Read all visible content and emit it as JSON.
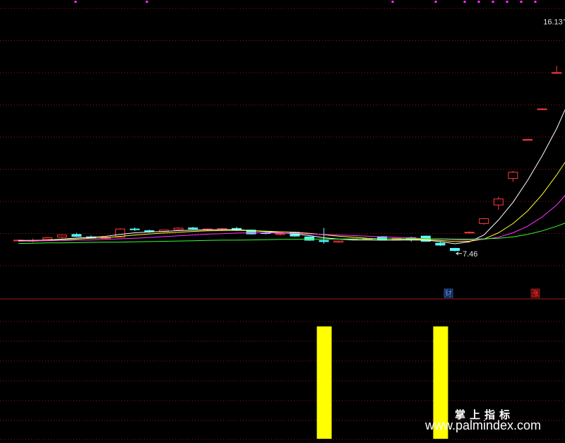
{
  "colors": {
    "background": "#000000",
    "grid": "#8b1a1a",
    "candle_up": "#ff3b3b",
    "candle_down": "#54ffff",
    "ma1": "#ffffff",
    "ma2": "#ffff33",
    "ma3": "#ff33ff",
    "ma4": "#33ff33",
    "volume_bar": "#ffff00",
    "marker_dot": "#ff33ff",
    "tag_cai": "#5aa0ff",
    "tag_zhang": "#ff4040"
  },
  "annotations": {
    "high_label": "16.13",
    "low_label": "7.46",
    "tag_cai": "财",
    "tag_zhang": "涨"
  },
  "watermark": {
    "line1": "掌上指标",
    "line2": "www.palmindex.com"
  },
  "chart_data": [
    {
      "type": "candlestick",
      "title": "",
      "ylim": [
        6.3,
        16.5
      ],
      "grid": true,
      "candles": [
        {
          "o": 8.0,
          "h": 8.03,
          "l": 7.98,
          "c": 8.01
        },
        {
          "o": 7.99,
          "h": 8.07,
          "l": 7.93,
          "c": 8.0
        },
        {
          "o": 8.04,
          "h": 8.12,
          "l": 8.0,
          "c": 8.1
        },
        {
          "o": 8.12,
          "h": 8.22,
          "l": 8.08,
          "c": 8.2
        },
        {
          "o": 8.22,
          "h": 8.28,
          "l": 8.13,
          "c": 8.15
        },
        {
          "o": 8.13,
          "h": 8.18,
          "l": 8.07,
          "c": 8.1
        },
        {
          "o": 8.08,
          "h": 8.15,
          "l": 8.04,
          "c": 8.12
        },
        {
          "o": 8.12,
          "h": 8.45,
          "l": 8.1,
          "c": 8.42
        },
        {
          "o": 8.42,
          "h": 8.48,
          "l": 8.35,
          "c": 8.4
        },
        {
          "o": 8.36,
          "h": 8.4,
          "l": 8.28,
          "c": 8.32
        },
        {
          "o": 8.33,
          "h": 8.4,
          "l": 8.3,
          "c": 8.38
        },
        {
          "o": 8.39,
          "h": 8.48,
          "l": 8.36,
          "c": 8.45
        },
        {
          "o": 8.46,
          "h": 8.5,
          "l": 8.4,
          "c": 8.42
        },
        {
          "o": 8.4,
          "h": 8.44,
          "l": 8.36,
          "c": 8.42
        },
        {
          "o": 8.41,
          "h": 8.45,
          "l": 8.37,
          "c": 8.43
        },
        {
          "o": 8.44,
          "h": 8.5,
          "l": 8.35,
          "c": 8.39
        },
        {
          "o": 8.38,
          "h": 8.4,
          "l": 8.22,
          "c": 8.24
        },
        {
          "o": 8.28,
          "h": 8.3,
          "l": 8.22,
          "c": 8.27
        },
        {
          "o": 8.22,
          "h": 8.27,
          "l": 8.18,
          "c": 8.25
        },
        {
          "o": 8.3,
          "h": 8.32,
          "l": 8.14,
          "c": 8.16
        },
        {
          "o": 8.13,
          "h": 8.15,
          "l": 7.99,
          "c": 8.01
        },
        {
          "o": 8.0,
          "h": 8.46,
          "l": 7.88,
          "c": 7.96
        },
        {
          "o": 7.94,
          "h": 8.0,
          "l": 7.92,
          "c": 7.98
        },
        {
          "o": 8.04,
          "h": 8.08,
          "l": 8.0,
          "c": 8.06
        },
        {
          "o": 8.05,
          "h": 8.09,
          "l": 8.02,
          "c": 8.07
        },
        {
          "o": 8.14,
          "h": 8.16,
          "l": 8.01,
          "c": 8.03
        },
        {
          "o": 8.03,
          "h": 8.1,
          "l": 8.0,
          "c": 8.08
        },
        {
          "o": 8.1,
          "h": 8.14,
          "l": 7.96,
          "c": 8.07
        },
        {
          "o": 8.16,
          "h": 8.18,
          "l": 7.95,
          "c": 7.97
        },
        {
          "o": 7.9,
          "h": 7.95,
          "l": 7.8,
          "c": 7.83
        },
        {
          "o": 7.71,
          "h": 7.73,
          "l": 7.6,
          "c": 7.63
        },
        {
          "o": 8.29,
          "h": 8.33,
          "l": 8.25,
          "c": 8.3
        },
        {
          "o": 8.62,
          "h": 8.82,
          "l": 8.58,
          "c": 8.8
        },
        {
          "o": 9.3,
          "h": 9.6,
          "l": 9.12,
          "c": 9.52
        },
        {
          "o": 10.27,
          "h": 10.55,
          "l": 10.15,
          "c": 10.5
        },
        {
          "o": 11.7,
          "h": 11.72,
          "l": 11.68,
          "c": 11.7
        },
        {
          "o": 12.82,
          "h": 12.84,
          "l": 12.8,
          "c": 12.82
        },
        {
          "o": 14.15,
          "h": 14.4,
          "l": 14.15,
          "c": 14.15
        },
        {
          "o": 15.52,
          "h": 16.13,
          "l": 15.48,
          "c": 16.12
        }
      ],
      "moving_averages": [
        {
          "values": [
            8.0,
            8.0,
            8.01,
            8.05,
            8.09,
            8.12,
            8.15,
            8.22,
            8.28,
            8.31,
            8.33,
            8.36,
            8.38,
            8.39,
            8.4,
            8.4,
            8.36,
            8.32,
            8.28,
            8.24,
            8.18,
            8.1,
            8.05,
            8.02,
            8.02,
            8.01,
            8.01,
            8.02,
            8.01,
            7.96,
            7.88,
            7.95,
            8.2,
            8.75,
            9.4,
            10.2,
            11.1,
            12.1,
            13.3
          ]
        },
        {
          "values": [
            7.99,
            7.99,
            8.0,
            8.02,
            8.05,
            8.08,
            8.1,
            8.15,
            8.2,
            8.24,
            8.27,
            8.3,
            8.33,
            8.35,
            8.36,
            8.37,
            8.36,
            8.34,
            8.32,
            8.3,
            8.26,
            8.21,
            8.16,
            8.12,
            8.08,
            8.06,
            8.05,
            8.04,
            8.03,
            8.0,
            7.96,
            7.97,
            8.05,
            8.28,
            8.62,
            9.08,
            9.68,
            10.4,
            11.2
          ]
        },
        {
          "values": [
            7.97,
            7.98,
            7.99,
            8.0,
            8.01,
            8.02,
            8.04,
            8.06,
            8.08,
            8.11,
            8.14,
            8.17,
            8.2,
            8.23,
            8.25,
            8.27,
            8.28,
            8.28,
            8.27,
            8.26,
            8.24,
            8.22,
            8.2,
            8.18,
            8.16,
            8.13,
            8.11,
            8.09,
            8.07,
            8.05,
            8.03,
            8.02,
            8.04,
            8.12,
            8.28,
            8.52,
            8.86,
            9.3,
            9.9
          ]
        },
        {
          "values": [
            7.89,
            7.9,
            7.91,
            7.91,
            7.92,
            7.93,
            7.94,
            7.94,
            7.95,
            7.96,
            7.97,
            7.98,
            7.99,
            8.0,
            8.01,
            8.01,
            8.02,
            8.03,
            8.04,
            8.04,
            8.05,
            8.05,
            8.05,
            8.06,
            8.06,
            8.06,
            8.06,
            8.06,
            8.06,
            8.06,
            8.05,
            8.05,
            8.06,
            8.08,
            8.13,
            8.22,
            8.35,
            8.52,
            8.72
          ]
        }
      ]
    },
    {
      "type": "bar",
      "title": "",
      "ylim": [
        0,
        1
      ],
      "grid": true,
      "bars": [
        {
          "index": 21,
          "value": 1
        },
        {
          "index": 29,
          "value": 1
        }
      ]
    }
  ]
}
